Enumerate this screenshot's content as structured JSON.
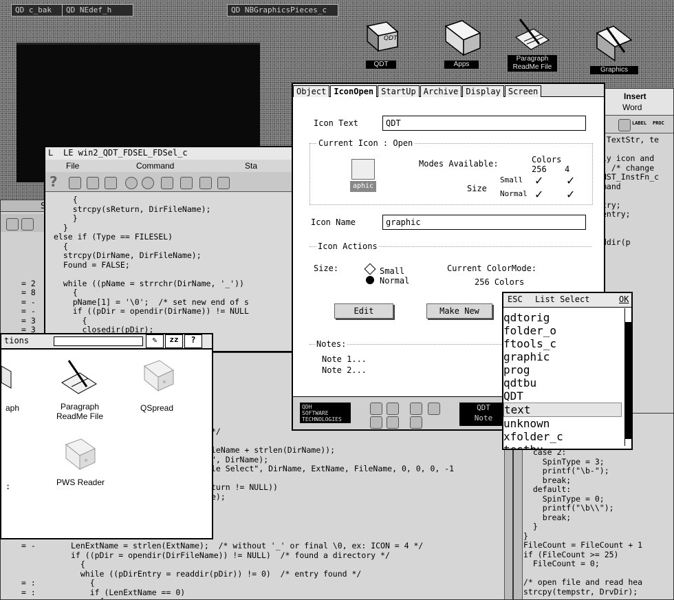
{
  "top_labels": [
    "QD c_bak",
    "QD NEdef_h",
    "QD NBGraphicsPieces_c"
  ],
  "desktop_icons": [
    "QDT",
    "Apps",
    "Paragraph ReadMe File",
    "Graphics"
  ],
  "right_panel": {
    "header": [
      "Insert",
      "Word"
    ],
    "lines": [
      ".TextStr, te",
      "",
      "ly icon and",
      "  /* change",
      "NST_InstFn_c",
      "mand",
      "",
      "try;",
      "entry;",
      "",
      "",
      "ddir(p"
    ]
  },
  "editor": {
    "title": "LE  win2_QDT_FDSEL_FDSel_c",
    "title_prefix": "L",
    "menu": [
      "File",
      "Command",
      "Sta"
    ],
    "code": [
      "    {",
      "    strcpy(sReturn, DirFileName);",
      "    }",
      "  }",
      "else if (Type == FILESEL)",
      "  {",
      "  strcpy(DirName, DirFileName);",
      "  Found = FALSE;",
      "",
      "  while ((pName = strrchr(DirName, '_'))",
      "    {",
      "    pName[1] = '\\0';  /* set new end of s",
      "    if ((pDir = opendir(DirName)) != NULL",
      "      {",
      "      closedir(pDir);"
    ]
  },
  "left_code_lines": [
    "",
    "",
    "",
    "",
    "",
    "",
    "",
    "= 2",
    "= 8",
    "= -",
    "= -",
    "= 3",
    "= 3"
  ],
  "bottom_code": {
    "tail_lines": [
      "*/",
      "",
      "leName + strlen(DirName));",
      "\", DirName);",
      "le Select\", DirName, ExtName, FileName, 0, 0, 0, -1",
      "",
      "turn != NULL))",
      "e);"
    ],
    "lines": [
      "LenExtName = strlen(ExtName);  /* without '_' or final \\0, ex: ICON = 4 */",
      "if ((pDir = opendir(DirFileName)) != NULL)  /* found a directory */",
      "  {",
      "  while ((pDirEntry = readdir(pDir)) != 0)  /* entry found */",
      "    {",
      "    if (LenExtName == 0)",
      "      {"
    ],
    "margin": [
      "= -",
      "",
      "",
      "",
      "= :",
      "= :"
    ]
  },
  "bottom_right_code": [
    "  case 2:",
    "    SpinType = 3;",
    "    printf(\"\\b-\");",
    "    break;",
    "  default:",
    "    SpinType = 0;",
    "    printf(\"\\b\\\\\");",
    "    break;",
    "  }",
    "}",
    "FileCount = FileCount + 1",
    "if (FileCount >= 25)",
    "  FileCount = 0;",
    "",
    "/* open file and read hea",
    "strcpy(tempstr, DrvDir);"
  ],
  "applications": {
    "title": "tions",
    "btn_z": "zz",
    "btn_help": "?",
    "icons": [
      {
        "label": "aph",
        "icon": "partial-icon"
      },
      {
        "label": "Paragraph ReadMe File",
        "icon": "paragraph-readme-icon"
      },
      {
        "label": "QSpread",
        "icon": "folder-icon"
      },
      {
        "label": ":",
        "icon": "none"
      },
      {
        "label": "PWS Reader",
        "icon": "folder-icon"
      }
    ]
  },
  "dialog": {
    "tabs": [
      "Object",
      "IconOpen",
      "StartUp",
      "Archive",
      "Display",
      "Screen"
    ],
    "active_tab": "IconOpen",
    "icon_text_label": "Icon Text",
    "icon_text_value": "QDT",
    "current_icon_label": "Current Icon : Open",
    "modes_label": "Modes Available:",
    "colors_label": "Colors",
    "colors": [
      "256",
      "4"
    ],
    "size_label": "Size",
    "sizes": [
      "Small",
      "Normal"
    ],
    "preview_caption": "aphic",
    "icon_name_label": "Icon Name",
    "icon_name_value": "graphic",
    "icon_actions_label": "Icon Actions",
    "size_field_label": "Size:",
    "size_small": "Small",
    "size_normal": "Normal",
    "colormode_label": "Current ColorMode:",
    "colormode_value": "256 Colors",
    "edit_button": "Edit",
    "make_new_button": "Make New",
    "notes_label": "Notes:",
    "notes": [
      "Note 1...",
      "Note 2..."
    ],
    "logo_text": [
      "QDH",
      "SOFTWARE",
      "TECHNOLOGIES"
    ],
    "footer_right": [
      "QDT",
      "Note"
    ]
  },
  "list_select": {
    "esc": "ESC",
    "title": "List Select",
    "ok": "OK",
    "items": [
      "qdtorig",
      "folder_o",
      "ftools_c",
      "graphic",
      "prog",
      "qdtbu",
      "QDT",
      "text",
      "unknown",
      "xfolder_c",
      "testbu"
    ],
    "highlighted": "text"
  }
}
